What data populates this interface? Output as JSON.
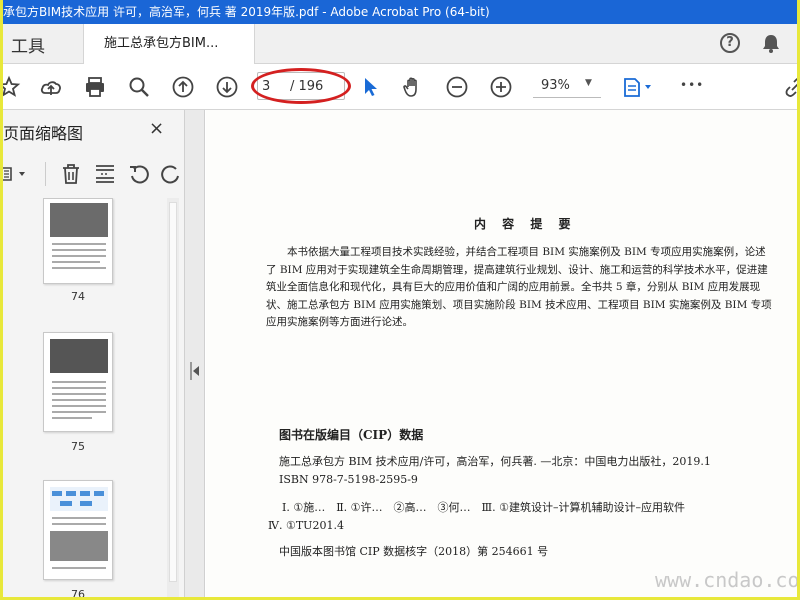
{
  "window": {
    "title": "承包方BIM技术应用 许可，高治军，何兵 著 2019年版.pdf - Adobe Acrobat Pro (64-bit)"
  },
  "tabs": {
    "tools": "工具",
    "doc": "施工总承包方BIM...",
    "close": "×"
  },
  "toolbar": {
    "page_current": "3",
    "page_total": "/ 196",
    "zoom": "93%",
    "more": "•••"
  },
  "panel": {
    "title": "页面缩略图",
    "close": "×",
    "thumbnails": [
      {
        "label": "74"
      },
      {
        "label": "75"
      },
      {
        "label": "76"
      }
    ]
  },
  "doc": {
    "heading": "内 容 提 要",
    "paragraph": "本书依据大量工程项目技术实践经验，并结合工程项目 BIM 实施案例及 BIM 专项应用实施案例，论述了 BIM 应用对于实现建筑全生命周期管理，提高建筑行业规划、设计、施工和运营的科学技术水平，促进建筑业全面信息化和现代化，具有巨大的应用价值和广阔的应用前景。全书共 5 章，分别从 BIM 应用发展现状、施工总承包方 BIM 应用实施策划、项目实施阶段 BIM 技术应用、工程项目 BIM 实施案例及 BIM 专项应用实施案例等方面进行论述。",
    "cip_heading": "图书在版编目（CIP）数据",
    "cip_lines": [
      "施工总承包方 BIM 技术应用/许可，高治军，何兵著. —北京：中国电力出版社，2019.1",
      "ISBN 978-7-5198-2595-9",
      "Ⅰ. ①施…　Ⅱ. ①许…　②高…　③何…　Ⅲ. ①建筑设计–计算机辅助设计–应用软件",
      "Ⅳ. ①TU201.4",
      "中国版本图书馆 CIP 数据核字（2018）第 254661 号"
    ]
  },
  "watermark": "www.cndao.com",
  "colors": {
    "titlebar": "#1a66d6",
    "accent": "#1a6bd6",
    "highlight": "#d42020"
  }
}
